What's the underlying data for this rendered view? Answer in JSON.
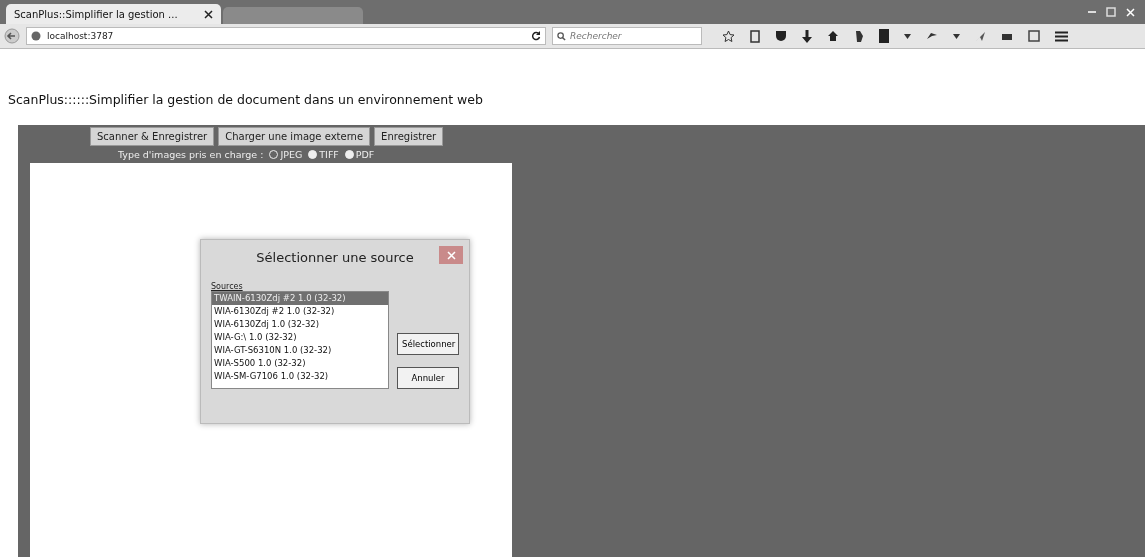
{
  "browser": {
    "tabs": [
      {
        "label": "ScanPlus::Simplifier la gestion ...",
        "selected": true
      },
      {
        "selected": false
      }
    ],
    "address": "localhost:3787",
    "search": {
      "placeholder": "Rechercher"
    }
  },
  "page": {
    "heading": "ScanPlus::::::Simplifier la gestion de document dans un environnement web",
    "buttons": [
      "Scanner & Enregistrer",
      "Charger une image externe",
      "Enregistrer"
    ],
    "formats_label": "Type d'images pris en charge :",
    "formats": [
      {
        "label": "JPEG",
        "checked": false
      },
      {
        "label": "TIFF",
        "checked": true
      },
      {
        "label": "PDF",
        "checked": true
      }
    ]
  },
  "dialog": {
    "title": "Sélectionner une source",
    "list_label": "Sources",
    "sources": [
      {
        "label": "TWAIN-6130Zdj #2 1.0 (32-32)",
        "selected": true
      },
      {
        "label": "WIA-6130Zdj #2 1.0 (32-32)",
        "selected": false
      },
      {
        "label": "WIA-6130Zdj 1.0 (32-32)",
        "selected": false
      },
      {
        "label": "WIA-G:\\ 1.0 (32-32)",
        "selected": false
      },
      {
        "label": "WIA-GT-S6310N 1.0 (32-32)",
        "selected": false
      },
      {
        "label": "WIA-S500 1.0 (32-32)",
        "selected": false
      },
      {
        "label": "WIA-SM-G7106 1.0 (32-32)",
        "selected": false
      }
    ],
    "buttons": [
      "Sélectionner",
      "Annuler"
    ]
  }
}
